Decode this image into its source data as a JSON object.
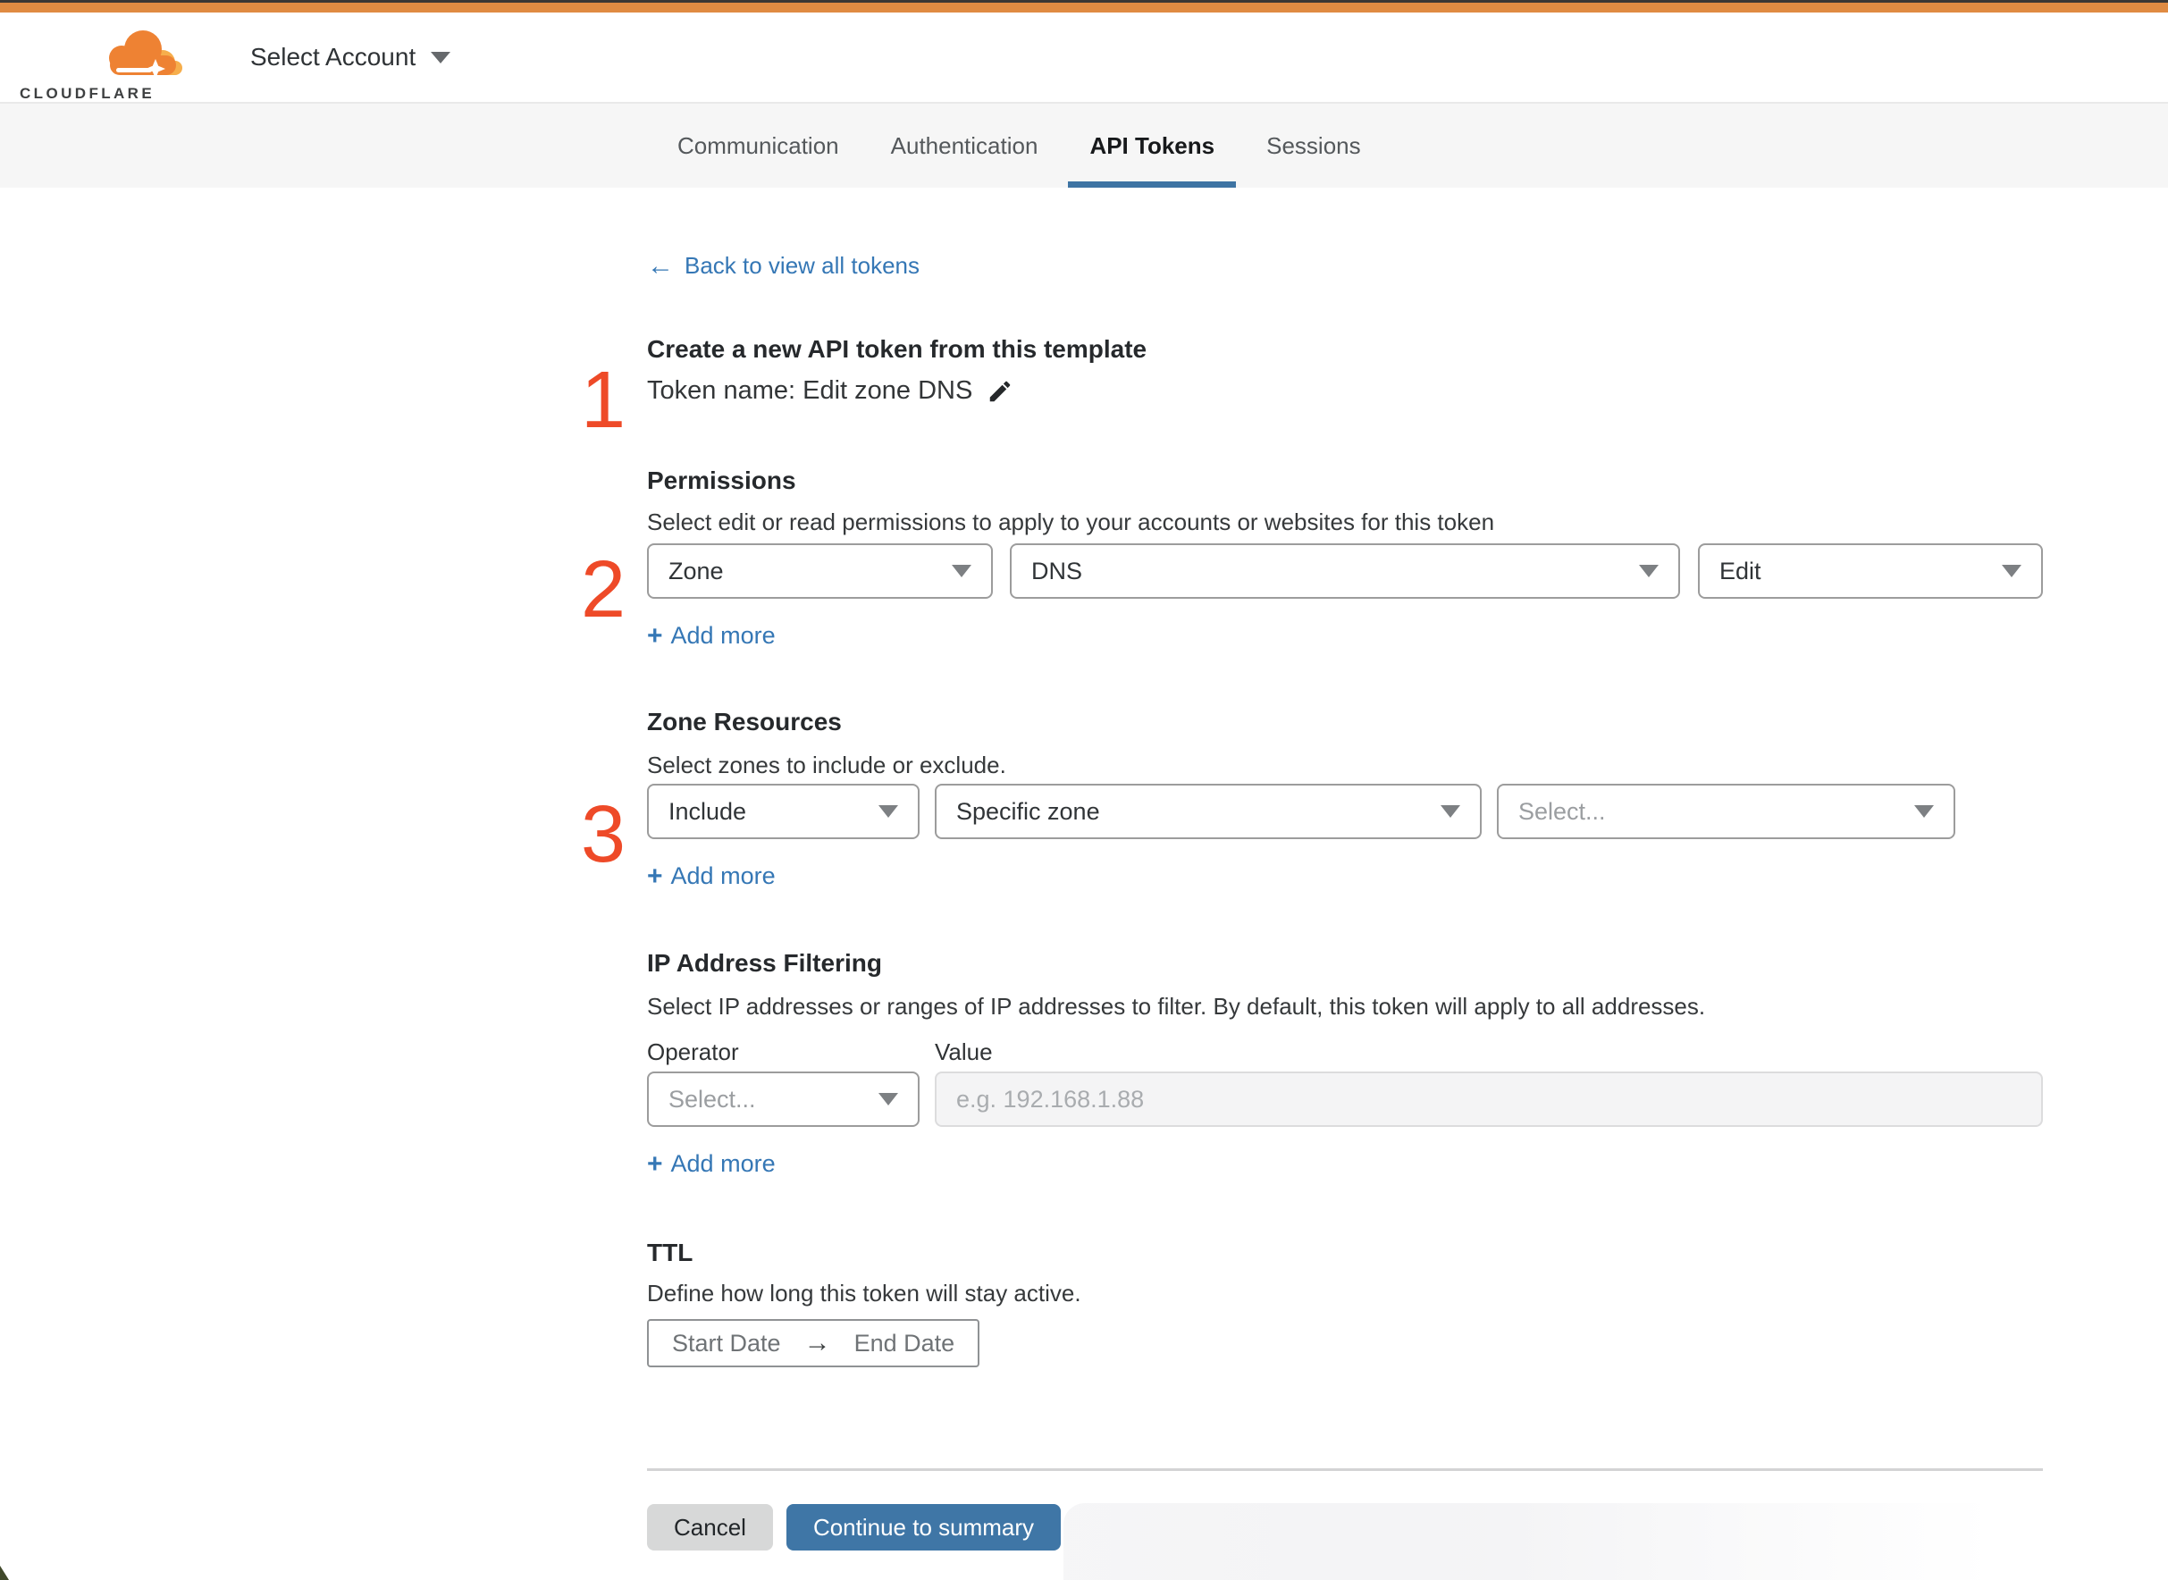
{
  "header": {
    "logo_text": "CLOUDFLARE",
    "account_selector_label": "Select Account"
  },
  "tabs": [
    {
      "label": "Communication",
      "active": false
    },
    {
      "label": "Authentication",
      "active": false
    },
    {
      "label": "API Tokens",
      "active": true
    },
    {
      "label": "Sessions",
      "active": false
    }
  ],
  "page": {
    "back_link": "Back to view all tokens",
    "title": "Create a new API token from this template",
    "token_name_line": "Token name: Edit zone DNS"
  },
  "steps": {
    "one": "1",
    "two": "2",
    "three": "3"
  },
  "sections": {
    "permissions": {
      "heading": "Permissions",
      "description": "Select edit or read permissions to apply to your accounts or websites for this token",
      "scope_value": "Zone",
      "service_value": "DNS",
      "access_value": "Edit",
      "add_more": "Add more"
    },
    "zone_resources": {
      "heading": "Zone Resources",
      "description": "Select zones to include or exclude.",
      "mode_value": "Include",
      "type_value": "Specific zone",
      "zone_placeholder": "Select...",
      "add_more": "Add more"
    },
    "ip_filtering": {
      "heading": "IP Address Filtering",
      "description": "Select IP addresses or ranges of IP addresses to filter. By default, this token will apply to all addresses.",
      "operator_label": "Operator",
      "value_label": "Value",
      "operator_placeholder": "Select...",
      "value_placeholder": "e.g. 192.168.1.88",
      "add_more": "Add more"
    },
    "ttl": {
      "heading": "TTL",
      "description": "Define how long this token will stay active.",
      "start_label": "Start Date",
      "end_label": "End Date"
    }
  },
  "footer": {
    "cancel_label": "Cancel",
    "continue_label": "Continue to summary"
  },
  "ui": {
    "plus": "+",
    "back_arrow": "←",
    "range_arrow": "→"
  },
  "colors": {
    "top_bar_orange": "#e08b42",
    "link_blue": "#3577b5",
    "primary_button_blue": "#3f76a6",
    "step_number_red": "#ee4a28",
    "active_tab_underline": "#3e74a3",
    "brand_orange": "#ee8233",
    "brand_light_orange": "#f6ae4c"
  }
}
